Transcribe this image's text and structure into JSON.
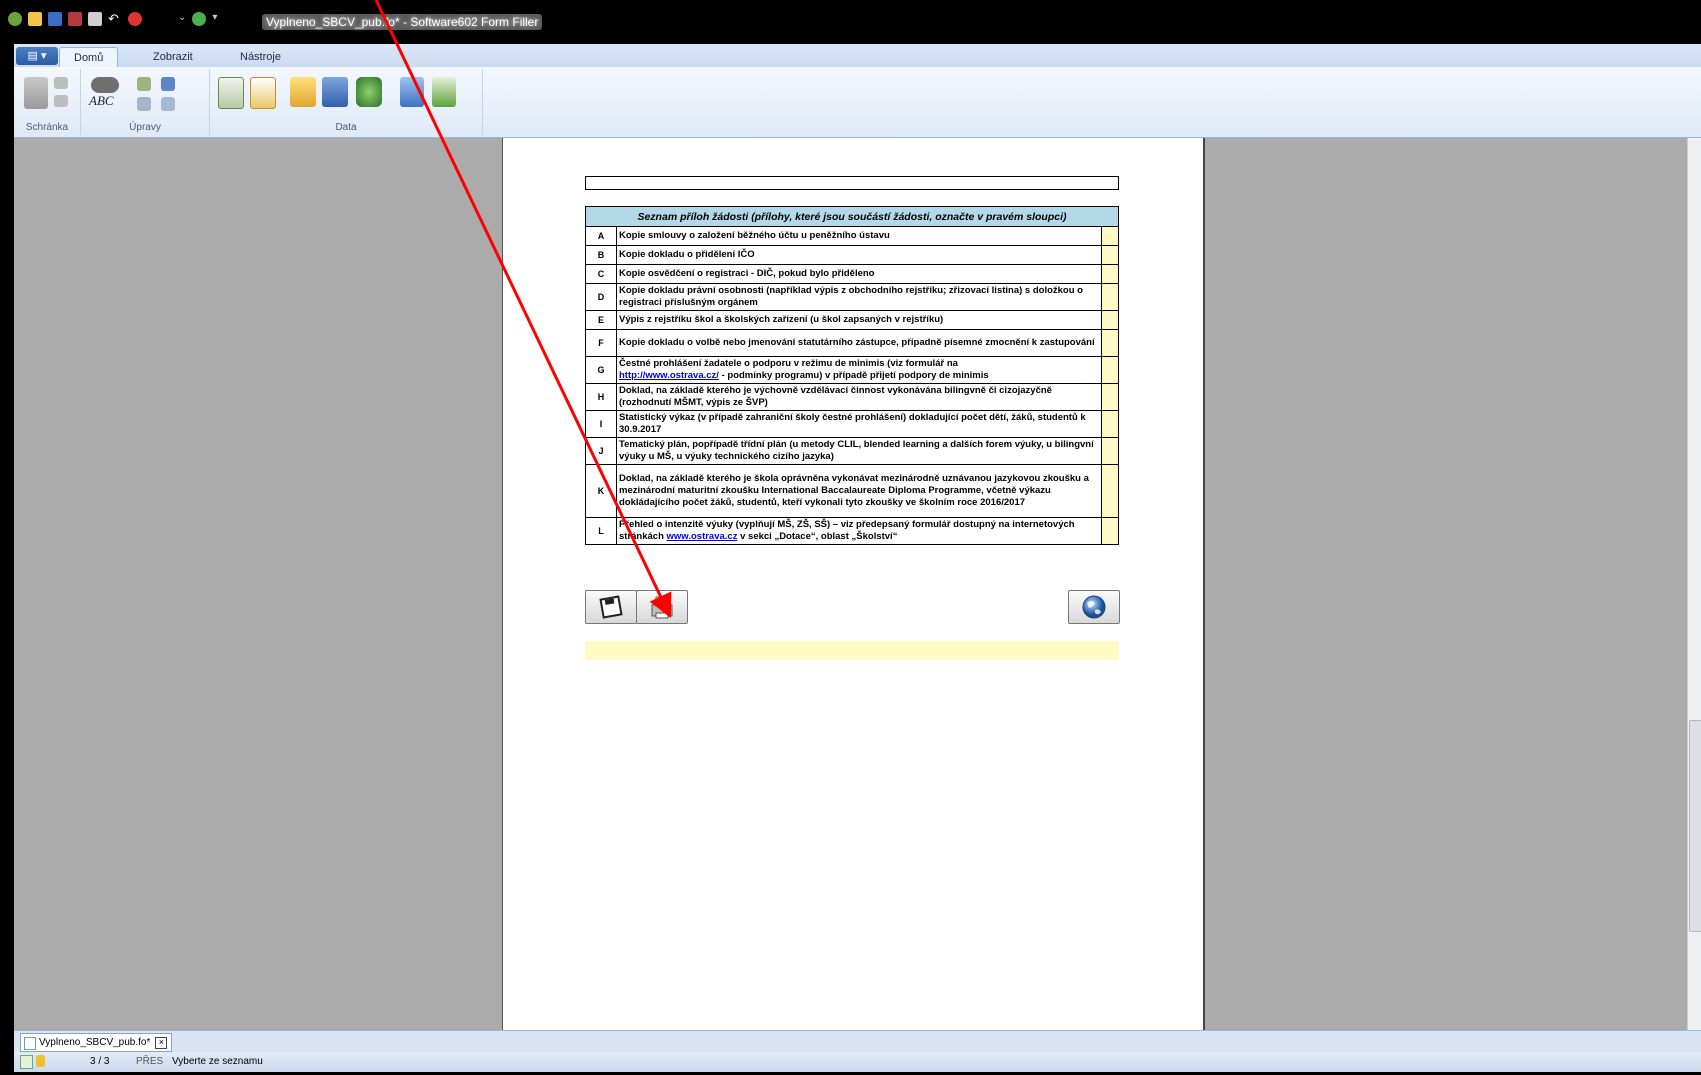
{
  "window": {
    "title": "Vyplneno_SBCV_pub.fo* - Software602 Form Filler"
  },
  "ribbon": {
    "tabs": [
      {
        "label": "Domů"
      },
      {
        "label": "Zobrazit"
      },
      {
        "label": "Nástroje"
      }
    ],
    "groups": [
      {
        "label": "Schránka"
      },
      {
        "label": "Úpravy"
      },
      {
        "label": "Data"
      }
    ],
    "abc_label": "ABC"
  },
  "form": {
    "table_header": "Seznam příloh žádosti (přílohy, které jsou součástí žádosti, označte v pravém sloupci)",
    "items": [
      {
        "letter": "A",
        "text": "Kopie smlouvy o založení běžného účtu u peněžního ústavu"
      },
      {
        "letter": "B",
        "text": "Kopie dokladu o přidělení IČO"
      },
      {
        "letter": "C",
        "text": "Kopie osvědčení o registraci - DIČ, pokud bylo přiděleno"
      },
      {
        "letter": "D",
        "text": "Kopie dokladu právní osobnosti (například výpis z obchodního rejstříku; zřizovací listina) s doložkou o registraci příslušným orgánem"
      },
      {
        "letter": "E",
        "text": "Výpis z rejstříku škol a školských zařízení (u škol zapsaných v rejstříku)"
      },
      {
        "letter": "F",
        "text": "Kopie dokladu o volbě nebo jmenování statutárního zástupce, případně písemné zmocnění k zastupování"
      },
      {
        "letter": "G",
        "text_before": "Čestné prohlášení žadatele o podporu v režimu de minimis (viz formulář na",
        "link": "http://www.ostrava.cz/",
        "text_after": " - podmínky programu) v případě přijetí podpory de minimis"
      },
      {
        "letter": "H",
        "text": "Doklad, na základě kterého je výchovně vzdělávací činnost vykonávána bilingvně či cizojazyčně (rozhodnutí MŠMT, výpis ze ŠVP)"
      },
      {
        "letter": "I",
        "text": "Statistický výkaz (v případě zahraniční školy čestné prohlášení) dokladující počet dětí, žáků, studentů k 30.9.2017"
      },
      {
        "letter": "J",
        "text": "Tematický plán, popřípadě třídní plán (u metody CLIL, blended learning a dalších forem výuky, u bilingvní výuky u MŠ, u výuky technického cizího jazyka)"
      },
      {
        "letter": "K",
        "text": "Doklad, na základě kterého je škola oprávněna vykonávat mezinárodně uznávanou jazykovou zkoušku a mezinárodní maturitní zkoušku International Baccalaureate Diploma Programme, včetně výkazu dokládajícího počet žáků, studentů, kteří vykonali tyto zkoušky ve školním roce 2016/2017"
      },
      {
        "letter": "L",
        "text_before": "Přehled o intenzitě výuky (vyplňují MŠ, ZŠ, SŠ) – viz předepsaný formulář dostupný na internetových stránkách ",
        "link": "www.ostrava.cz",
        "text_after": " v sekci „Dotace“, oblast „Školství“"
      }
    ]
  },
  "doc_tab": {
    "label": "Vyplneno_SBCV_pub.fo*"
  },
  "status": {
    "page": "3 / 3",
    "mode": "PŘES",
    "message": "Vyberte ze seznamu"
  },
  "colors": {
    "annotation_arrow": "#ff0000",
    "checkbox_fill": "#fffac3",
    "table_header_bg": "#b3d9e8"
  }
}
